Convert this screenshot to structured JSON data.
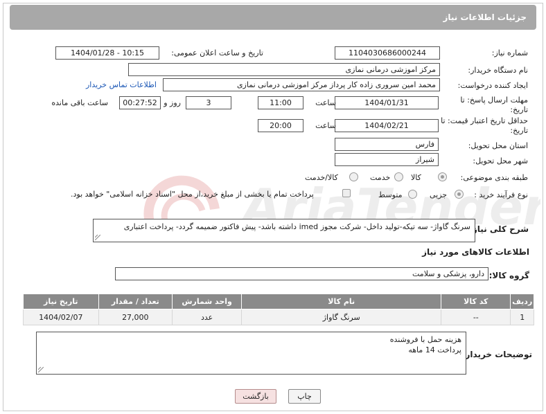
{
  "header": {
    "title": "جزئیات اطلاعات نیاز"
  },
  "fields": {
    "need_number_label": "شماره نیاز:",
    "need_number": "1104030686000244",
    "announce_label": "تاریخ و ساعت اعلان عمومی:",
    "announce_value": "1404/01/28 - 10:15",
    "buyer_org_label": "نام دستگاه خریدار:",
    "buyer_org": "مرکز اموزشی درمانی نمازی",
    "creator_label": "ایجاد کننده درخواست:",
    "creator": "محمد امین سروری زاده کار پرداز مرکز اموزشی درمانی نمازی",
    "contact_link": "اطلاعات تماس خریدار",
    "deadline_label": "مهلت ارسال پاسخ: تا تاریخ:",
    "deadline_date": "1404/01/31",
    "time_label": "ساعت",
    "deadline_time": "11:00",
    "days_value": "3",
    "days_label": "روز و",
    "remaining_time": "00:27:52",
    "remaining_label": "ساعت باقی مانده",
    "validity_label": "حداقل تاریخ اعتبار قیمت: تا تاریخ:",
    "validity_date": "1404/02/21",
    "validity_time": "20:00",
    "province_label": "استان محل تحویل:",
    "province": "فارس",
    "city_label": "شهر محل تحویل:",
    "city": "شیراز",
    "category_label": "طبقه بندی موضوعی:",
    "category_options": [
      "کالا",
      "خدمت",
      "کالا/خدمت"
    ],
    "purchase_label": "نوع فرآیند خرید :",
    "purchase_options": [
      "جزیی",
      "متوسط"
    ],
    "payment_note": "پرداخت تمام یا بخشی از مبلغ خرید،از محل \"اسناد خزانه اسلامی\" خواهد بود."
  },
  "description": {
    "label": "شرح کلی نیاز:",
    "text": "سرنگ گاواژ- سه تیکه-تولید داخل- شرکت مجوز imed داشته باشد- پیش فاکتور ضمیمه گردد- پرداخت اعتباری"
  },
  "goods": {
    "section_title": "اطلاعات کالاهای مورد نیاز",
    "group_label": "گروه کالا:",
    "group_value": "دارو، پزشکی و سلامت",
    "columns": [
      "ردیف",
      "کد کالا",
      "نام کالا",
      "واحد شمارش",
      "تعداد / مقدار",
      "تاریخ نیاز"
    ],
    "rows": [
      {
        "row": "1",
        "code": "--",
        "name": "سرنگ گاواژ",
        "unit": "عدد",
        "qty": "27,000",
        "date": "1404/02/07"
      }
    ]
  },
  "buyer_notes": {
    "label": "توضیحات خریدار:",
    "line1": "هزینه حمل با فروشنده",
    "line2": "پرداخت 14 ماهه"
  },
  "buttons": {
    "print": "چاپ",
    "back": "بازگشت"
  },
  "watermark": {
    "brand": "AriaTender.neT"
  }
}
